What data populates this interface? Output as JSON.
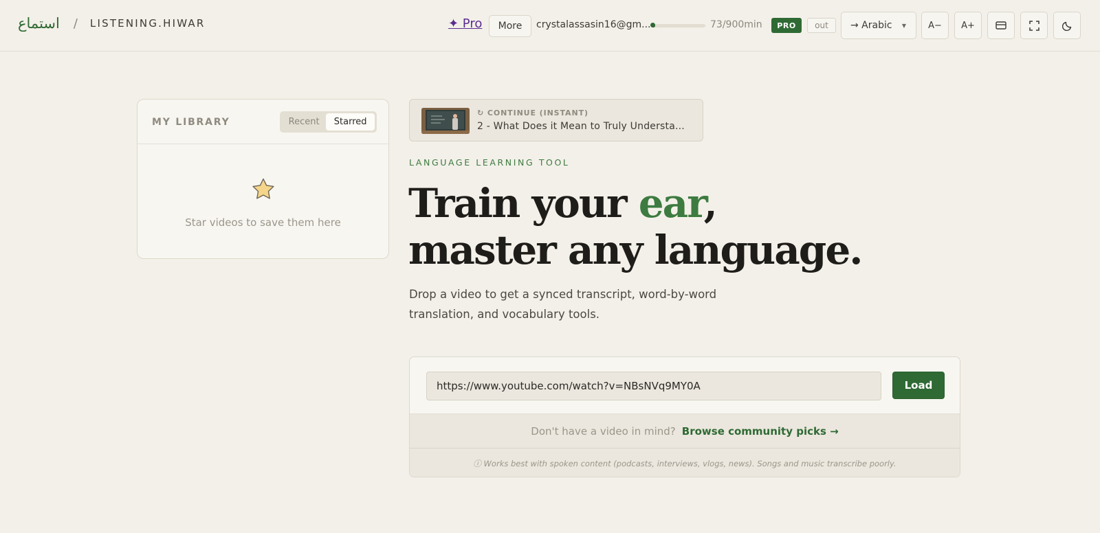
{
  "brand": {
    "arabic": "استماع",
    "separator": "/",
    "name": "LISTENING.HIWAR"
  },
  "header": {
    "pro_link": "✦ Pro",
    "more": "More",
    "email": "crystalassasin16@gm...",
    "usage_text": "73/900min",
    "usage_fraction": 0.081,
    "badge": "PRO",
    "out": "out",
    "language": "→ Arabic",
    "font_decrease": "A−",
    "font_increase": "A+",
    "icons": [
      "subtitles-icon",
      "fullscreen-icon",
      "moon-icon"
    ]
  },
  "library": {
    "title": "MY LIBRARY",
    "tabs": [
      "Recent",
      "Starred"
    ],
    "active_tab": "Starred",
    "empty_text": "Star videos to save them here"
  },
  "continue": {
    "label": "↻ CONTINUE (INSTANT)",
    "title": "2 - What Does it Mean to Truly Understa..."
  },
  "hero": {
    "eyebrow": "LANGUAGE LEARNING TOOL",
    "headline_1": "Train your ",
    "headline_accent": "ear",
    "headline_2": ",",
    "headline_line2": "master any language.",
    "subtitle": "Drop a video to get a synced transcript, word-by-word translation, and vocabulary tools."
  },
  "loader": {
    "url_value": "https://www.youtube.com/watch?v=NBsNVq9MY0A",
    "load_label": "Load",
    "browse_question": "Don't have a video in mind?",
    "browse_link": "Browse community picks →",
    "note": "ⓘ Works best with spoken content (podcasts, interviews, vlogs, news). Songs and music transcribe poorly."
  },
  "colors": {
    "accent": "#2f6a34",
    "background": "#f3f0e9",
    "pro_link": "#5b2d8f"
  }
}
